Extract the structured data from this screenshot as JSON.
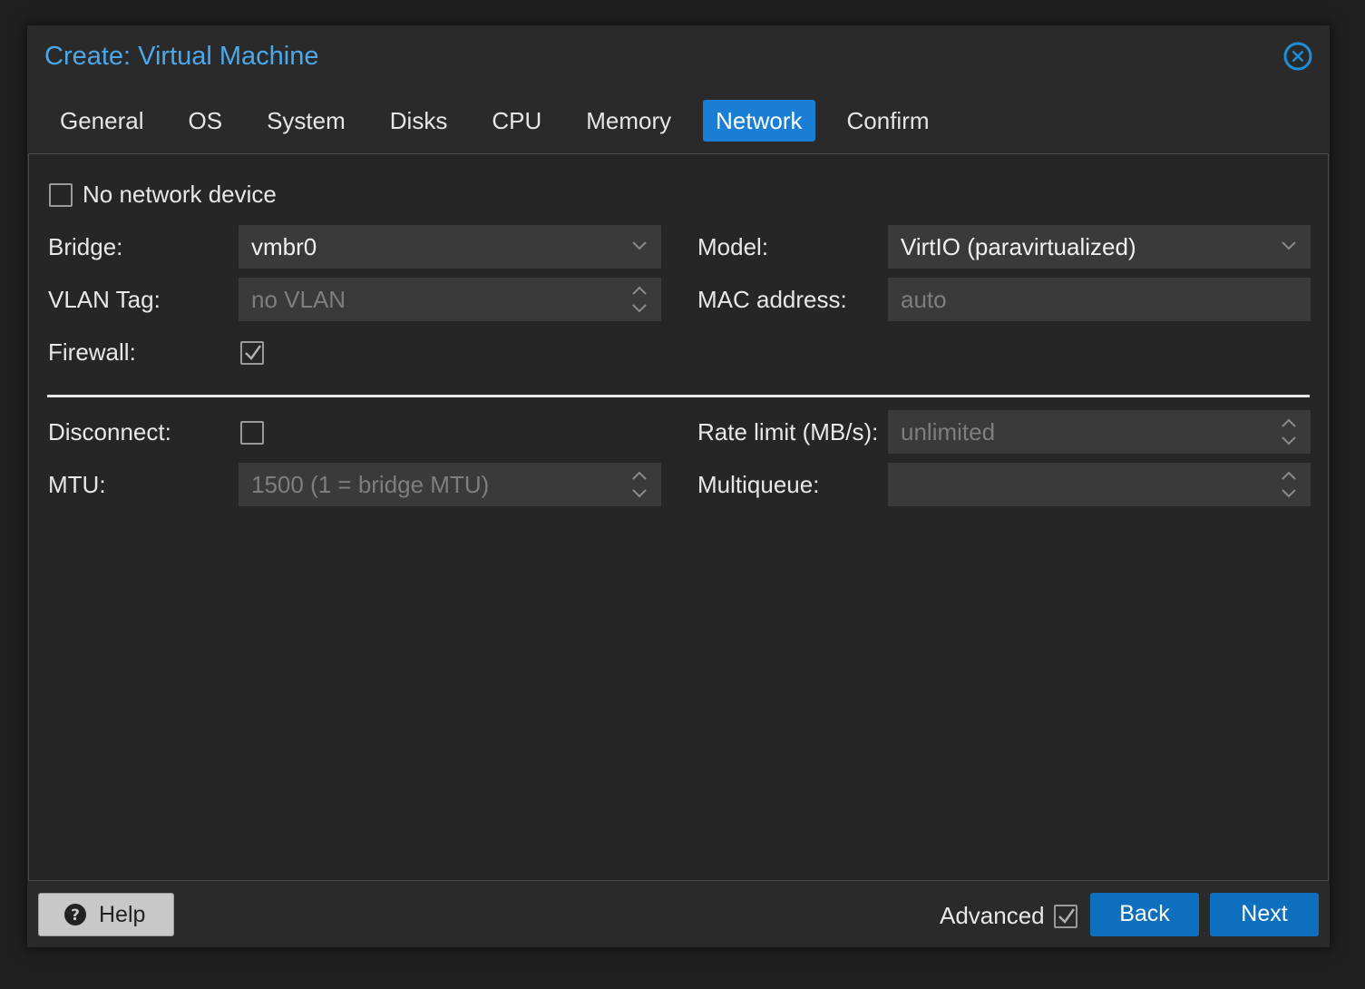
{
  "window": {
    "title": "Create: Virtual Machine",
    "close_icon": "close-circle-icon"
  },
  "tabs": [
    {
      "label": "General",
      "active": false
    },
    {
      "label": "OS",
      "active": false
    },
    {
      "label": "System",
      "active": false
    },
    {
      "label": "Disks",
      "active": false
    },
    {
      "label": "CPU",
      "active": false
    },
    {
      "label": "Memory",
      "active": false
    },
    {
      "label": "Network",
      "active": true
    },
    {
      "label": "Confirm",
      "active": false
    }
  ],
  "form": {
    "no_network_device": {
      "label": "No network device",
      "checked": false
    },
    "bridge": {
      "label": "Bridge:",
      "value": "vmbr0"
    },
    "vlan_tag": {
      "label": "VLAN Tag:",
      "placeholder": "no VLAN"
    },
    "firewall": {
      "label": "Firewall:",
      "checked": true
    },
    "model": {
      "label": "Model:",
      "value": "VirtIO (paravirtualized)"
    },
    "mac_address": {
      "label": "MAC address:",
      "placeholder": "auto"
    },
    "disconnect": {
      "label": "Disconnect:",
      "checked": false
    },
    "mtu": {
      "label": "MTU:",
      "placeholder": "1500 (1 = bridge MTU)"
    },
    "rate_limit": {
      "label": "Rate limit (MB/s):",
      "placeholder": "unlimited"
    },
    "multiqueue": {
      "label": "Multiqueue:",
      "placeholder": ""
    }
  },
  "footer": {
    "help_label": "Help",
    "advanced_label": "Advanced",
    "advanced_checked": true,
    "back_label": "Back",
    "next_label": "Next"
  },
  "colors": {
    "accent": "#1a7ed4",
    "title": "#4aa8ec",
    "button": "#0d6fbd"
  }
}
